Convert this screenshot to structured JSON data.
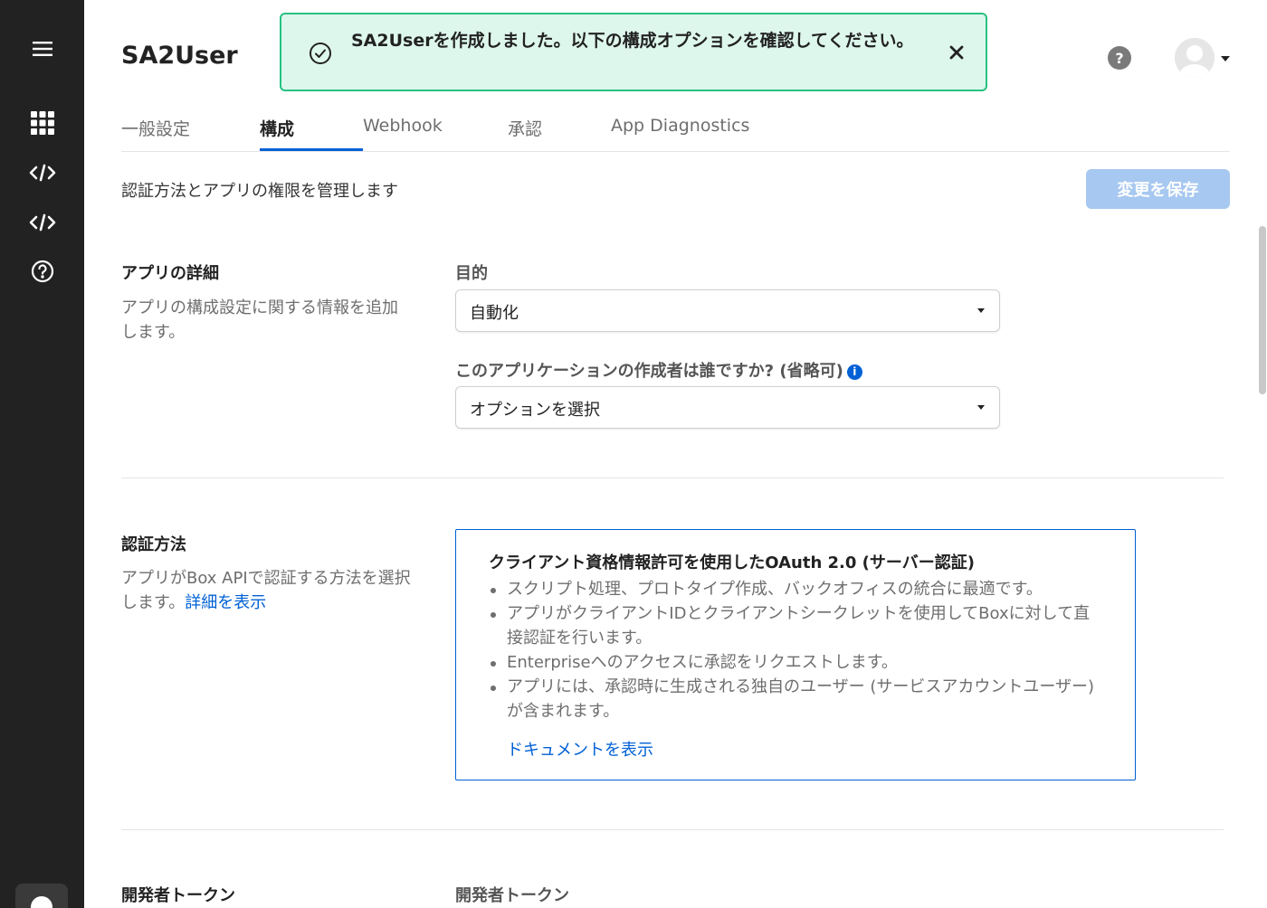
{
  "nav": {
    "items": [
      "menu-icon",
      "apps-grid-icon",
      "code-icon",
      "code-icon",
      "help-circle-icon"
    ]
  },
  "header": {
    "title": "SA2User",
    "help_label": "?"
  },
  "toast": {
    "message": "SA2Userを作成しました。以下の構成オプションを確認してください。"
  },
  "tabs": [
    {
      "label": "一般設定"
    },
    {
      "label": "構成",
      "active": true
    },
    {
      "label": "Webhook"
    },
    {
      "label": "承認"
    },
    {
      "label": "App Diagnostics"
    }
  ],
  "page": {
    "description": "認証方法とアプリの権限を管理します",
    "save_label": "変更を保存"
  },
  "app_details": {
    "title": "アプリの詳細",
    "description": "アプリの構成設定に関する情報を追加します。",
    "purpose_label": "目的",
    "purpose_value": "自動化",
    "creator_label": "このアプリケーションの作成者は誰ですか? (省略可)",
    "creator_value": "オプションを選択"
  },
  "auth": {
    "title": "認証方法",
    "description": "アプリがBox APIで認証する方法を選択します。",
    "details_link": "詳細を表示",
    "card_title": "クライアント資格情報許可を使用したOAuth 2.0 (サーバー認証)",
    "bullets": [
      "スクリプト処理、プロトタイプ作成、バックオフィスの統合に最適です。",
      "アプリがクライアントIDとクライアントシークレットを使用してBoxに対して直接認証を行います。",
      "Enterpriseへのアクセスに承認をリクエストします。",
      "アプリには、承認時に生成される独自のユーザー (サービスアカウントユーザー) が含まれます。"
    ],
    "doc_link": "ドキュメントを表示"
  },
  "dev_token": {
    "title": "開発者トークン",
    "label": "開発者トークン"
  },
  "colors": {
    "rail": "#222222",
    "accent": "#0061d5",
    "toast_bg": "#def7ed",
    "toast_border": "#26c281",
    "save_disabled": "#a7c8f0"
  }
}
